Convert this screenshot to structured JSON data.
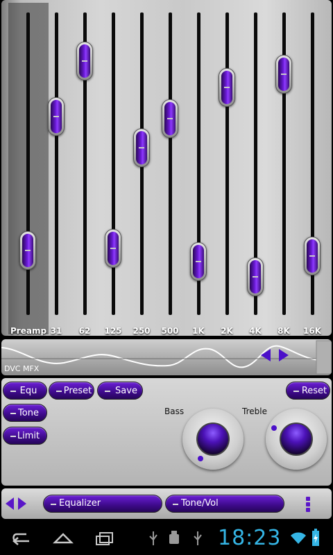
{
  "equalizer": {
    "bands": [
      {
        "label": "Preamp",
        "level": 0.17
      },
      {
        "label": "31",
        "level": 0.68
      },
      {
        "label": "62",
        "level": 0.89
      },
      {
        "label": "125",
        "level": 0.18
      },
      {
        "label": "250",
        "level": 0.56
      },
      {
        "label": "500",
        "level": 0.67
      },
      {
        "label": "1K",
        "level": 0.13
      },
      {
        "label": "2K",
        "level": 0.79
      },
      {
        "label": "4K",
        "level": 0.07
      },
      {
        "label": "8K",
        "level": 0.84
      },
      {
        "label": "16K",
        "level": 0.15
      }
    ]
  },
  "wave": {
    "label": "DVC MFX"
  },
  "controls": {
    "equ": "Equ",
    "tone": "Tone",
    "limit": "Limit",
    "preset": "Preset",
    "save": "Save",
    "reset": "Reset",
    "bass_label": "Bass",
    "treble_label": "Treble"
  },
  "tabs": {
    "equalizer": "Equalizer",
    "tone_vol": "Tone/Vol"
  },
  "status": {
    "clock": "18:23"
  },
  "colors": {
    "accent": "#5a16c8",
    "clock": "#35b5e5"
  }
}
